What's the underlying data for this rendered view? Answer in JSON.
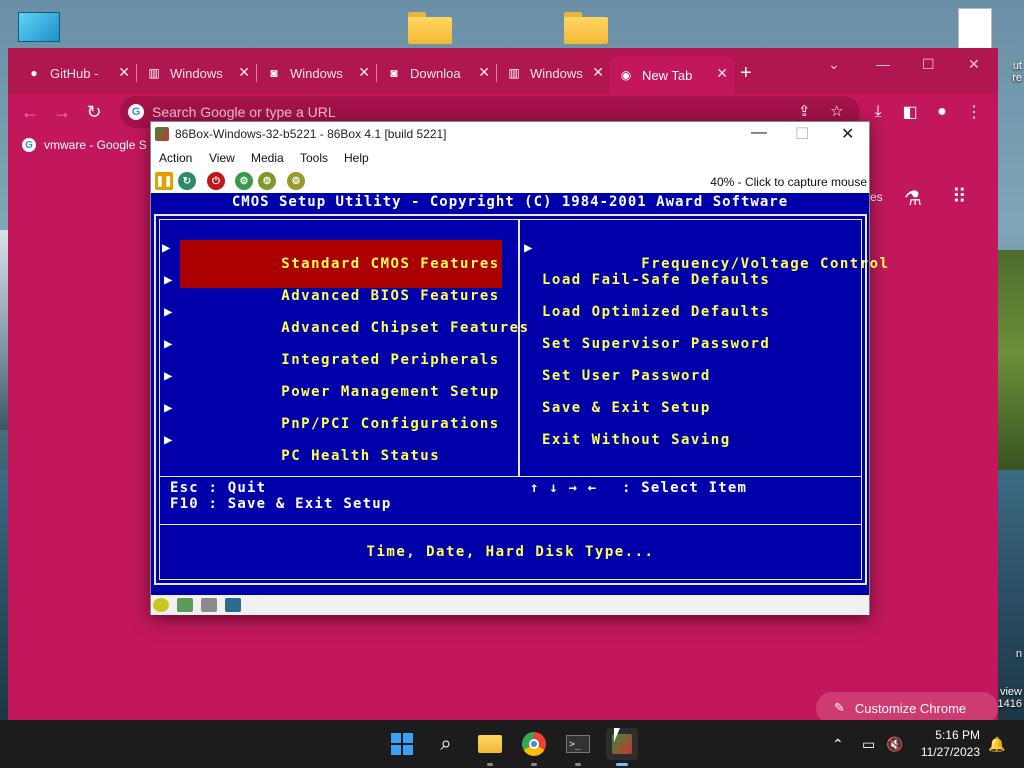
{
  "desktop": {
    "edge_text_top": [
      "ut",
      "re"
    ],
    "edge_text_bottom": [
      "n",
      "view",
      "1416"
    ]
  },
  "chrome": {
    "tabs": [
      {
        "title": "GitHub - ",
        "icon": "github-icon"
      },
      {
        "title": "Windows",
        "icon": "archive-icon"
      },
      {
        "title": "Windows",
        "icon": "page-icon"
      },
      {
        "title": "Downloa",
        "icon": "page-icon"
      },
      {
        "title": "Windows",
        "icon": "archive-icon"
      },
      {
        "title": "New Tab",
        "icon": "chrome-icon",
        "active": true
      }
    ],
    "omnibox_placeholder": "Search Google or type a URL",
    "bookmark": "vmware - Google S",
    "page_partial_text": "es",
    "customize_label": "Customize Chrome",
    "accent_color": "#c2185b"
  },
  "vm": {
    "title": "86Box-Windows-32-b5221 - 86Box 4.1 [build 5221]",
    "menu": [
      "Action",
      "View",
      "Media",
      "Tools",
      "Help"
    ],
    "capture_hint": "40% - Click to capture mouse",
    "bios": {
      "header": "CMOS Setup Utility - Copyright (C) 1984-2001 Award Software",
      "left_items": [
        "Standard CMOS Features",
        "Advanced BIOS Features",
        "Advanced Chipset Features",
        "Integrated Peripherals",
        "Power Management Setup",
        "PnP/PCI Configurations",
        "PC Health Status"
      ],
      "right_items": [
        "Frequency/Voltage Control",
        "Load Fail-Safe Defaults",
        "Load Optimized Defaults",
        "Set Supervisor Password",
        "Set User Password",
        "Save & Exit Setup",
        "Exit Without Saving"
      ],
      "selected_item": "Standard CMOS Features",
      "keys": {
        "esc": "Esc : Quit",
        "f10": "F10 : Save & Exit Setup",
        "arrows": "↑ ↓ → ←",
        "select": ": Select Item"
      },
      "help_text": "Time, Date, Hard Disk Type...",
      "colors": {
        "background": "#0000aa",
        "item": "#ffff55",
        "selected_bg": "#aa0000"
      }
    }
  },
  "taskbar": {
    "time": "5:16 PM",
    "date": "11/27/2023"
  }
}
